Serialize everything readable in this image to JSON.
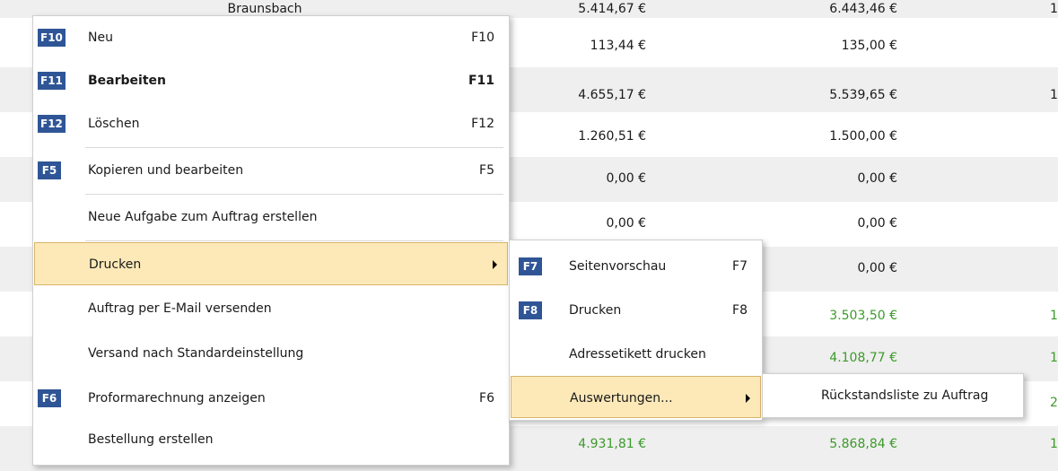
{
  "table": {
    "top_row": {
      "name": "Braunsbach",
      "a": "5.414,67 €",
      "b": "6.443,46 €",
      "c": "1"
    },
    "rows": [
      {
        "a": "113,44 €",
        "b": "135,00 €",
        "c": ""
      },
      {
        "a": "4.655,17 €",
        "b": "5.539,65 €",
        "c": "1"
      },
      {
        "a": "1.260,51 €",
        "b": "1.500,00 €",
        "c": ""
      },
      {
        "a": "0,00 €",
        "b": "0,00 €",
        "c": ""
      },
      {
        "a": "0,00 €",
        "b": "0,00 €",
        "c": ""
      },
      {
        "a": "",
        "b": "0,00 €",
        "c": ""
      },
      {
        "a": "",
        "b": "3.503,50 €",
        "c": "1"
      },
      {
        "a": "",
        "b": "4.108,77 €",
        "c": "1"
      },
      {
        "a": "",
        "b": "",
        "c": "2"
      },
      {
        "a": "4.931,81 €",
        "b": "5.868,84 €",
        "c": "1"
      }
    ],
    "green_color": "#3c9a2a"
  },
  "context_menu": {
    "items": [
      {
        "key": "F10",
        "label": "Neu",
        "shortcut": "F10"
      },
      {
        "key": "F11",
        "label": "Bearbeiten",
        "shortcut": "F11"
      },
      {
        "key": "F12",
        "label": "Löschen",
        "shortcut": "F12"
      },
      {
        "key": "F5",
        "label": "Kopieren und bearbeiten",
        "shortcut": "F5"
      },
      {
        "key": "",
        "label": "Neue Aufgabe zum Auftrag erstellen",
        "shortcut": ""
      },
      {
        "key": "",
        "label": "Drucken",
        "shortcut": ""
      },
      {
        "key": "",
        "label": "Auftrag per E-Mail versenden",
        "shortcut": ""
      },
      {
        "key": "",
        "label": "Versand nach Standardeinstellung",
        "shortcut": ""
      },
      {
        "key": "F6",
        "label": "Proformarechnung anzeigen",
        "shortcut": "F6"
      },
      {
        "key": "",
        "label": "Bestellung erstellen",
        "shortcut": ""
      }
    ]
  },
  "print_submenu": {
    "items": [
      {
        "key": "F7",
        "label": "Seitenvorschau",
        "shortcut": "F7"
      },
      {
        "key": "F8",
        "label": "Drucken",
        "shortcut": "F8"
      },
      {
        "key": "",
        "label": "Adressetikett drucken",
        "shortcut": ""
      },
      {
        "key": "",
        "label": "Auswertungen...",
        "shortcut": ""
      }
    ]
  },
  "reports_submenu": {
    "items": [
      {
        "label": "Rückstandsliste zu Auftrag"
      }
    ]
  },
  "colors": {
    "key_badge": "#2f5597",
    "highlight": "#fde9b8"
  }
}
